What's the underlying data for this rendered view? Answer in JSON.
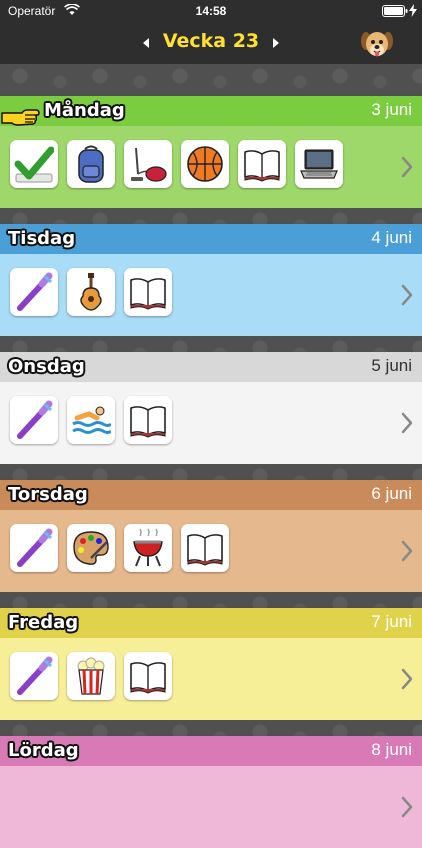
{
  "status_bar": {
    "carrier": "Operatör",
    "time": "14:58"
  },
  "nav": {
    "week_title": "Vecka 23"
  },
  "days": [
    {
      "name": "Måndag",
      "date": "3 juni",
      "color": "#9fd86a",
      "head_color": "#7ccc3f",
      "activities": [
        "checkmark-icon",
        "backpack-icon",
        "vacuum-cleaner-icon",
        "basketball-icon",
        "book-icon",
        "laptop-icon"
      ]
    },
    {
      "name": "Tisdag",
      "date": "4 juni",
      "color": "#a9dcf6",
      "head_color": "#4a9fd6",
      "activities": [
        "toothbrush-icon",
        "guitar-icon",
        "book-icon"
      ]
    },
    {
      "name": "Onsdag",
      "date": "5 juni",
      "color": "#f4f4f4",
      "head_color": "#d8d8d8",
      "activities": [
        "toothbrush-icon",
        "swimming-icon",
        "book-icon"
      ]
    },
    {
      "name": "Torsdag",
      "date": "6 juni",
      "color": "#e6b88d",
      "head_color": "#c98b59",
      "activities": [
        "toothbrush-icon",
        "paint-palette-icon",
        "grill-icon",
        "book-icon"
      ]
    },
    {
      "name": "Fredag",
      "date": "7 juni",
      "color": "#f7ef98",
      "head_color": "#e0d24a",
      "activities": [
        "toothbrush-icon",
        "popcorn-icon",
        "book-icon"
      ]
    },
    {
      "name": "Lördag",
      "date": "8 juni",
      "color": "#f0b8d8",
      "head_color": "#d77ab5",
      "activities": []
    }
  ]
}
